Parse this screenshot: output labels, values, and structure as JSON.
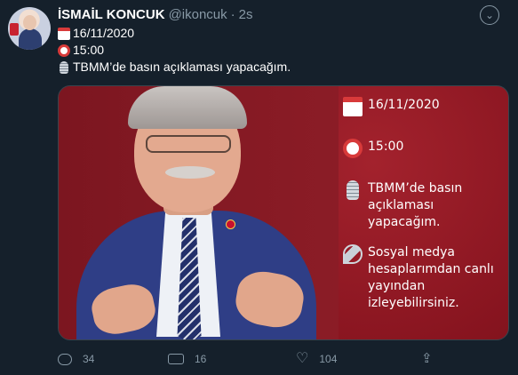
{
  "author": {
    "display_name": "İSMAİL KONCUK",
    "handle": "@ikoncuk",
    "separator": "·",
    "time": "2s"
  },
  "tweet": {
    "lines": [
      {
        "icon": "calendar-icon",
        "text": "16/11/2020"
      },
      {
        "icon": "alarm-clock-icon",
        "text": "15:00"
      },
      {
        "icon": "microphone-icon",
        "text": "TBMM’de basın açıklaması yapacağım."
      }
    ]
  },
  "media": {
    "items": [
      {
        "icon": "calendar-icon",
        "text": "16/11/2020"
      },
      {
        "icon": "alarm-clock-icon",
        "text": "15:00"
      },
      {
        "icon": "microphone-icon",
        "text": "TBMM’de basın açıklaması yapacağım."
      },
      {
        "icon": "satellite-dish-icon",
        "text": "Sosyal medya hesaplarımdan canlı yayından izleyebilirsiniz."
      }
    ]
  },
  "actions": {
    "reply_count": "34",
    "retweet_count": "16",
    "like_count": "104"
  },
  "icons": {
    "more": "chevron-down-icon",
    "reply": "reply-icon",
    "retweet": "retweet-icon",
    "like": "heart-icon",
    "share": "share-icon"
  },
  "colors": {
    "background": "#15202b",
    "secondary_text": "#8899a6",
    "media_background": "#87141f"
  }
}
